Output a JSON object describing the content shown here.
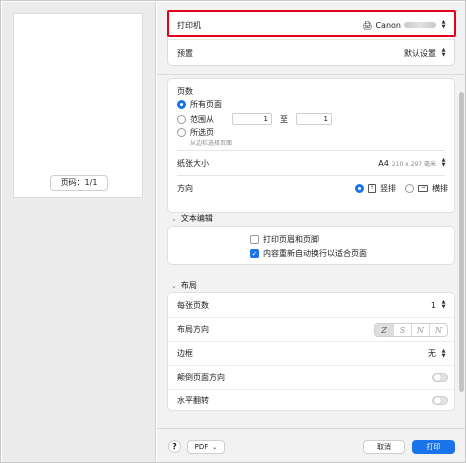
{
  "preview": {
    "page_indicator": "页码：1/1"
  },
  "printer": {
    "label": "打印机",
    "name": "Canon",
    "name_obscured": true
  },
  "preset": {
    "label": "预置",
    "value": "默认设置"
  },
  "pages": {
    "title": "页数",
    "all_pages": "所有页面",
    "range_label": "范围从",
    "range_from": "1",
    "range_to_label": "至",
    "range_to": "1",
    "selection": "所选页",
    "selection_hint": "从边栏选择页面",
    "selected_option": "all_pages"
  },
  "paper_size": {
    "label": "纸张大小",
    "value": "A4",
    "dims": "210 x 297 毫米"
  },
  "orientation": {
    "label": "方向",
    "portrait": "竖排",
    "landscape": "横排",
    "selected": "portrait"
  },
  "text_edit": {
    "section_title": "文本编辑",
    "print_headers": "打印页眉和页脚",
    "print_headers_checked": false,
    "rewrap": "内容重新自动换行以适合页面",
    "rewrap_checked": true
  },
  "layout": {
    "section_title": "布局",
    "pages_per_sheet_label": "每张页数",
    "pages_per_sheet_value": "1",
    "direction_label": "布局方向",
    "direction_options": [
      "Z",
      "S",
      "N",
      "N"
    ],
    "border_label": "边框",
    "border_value": "无",
    "reverse_label": "颠倒页面方向",
    "reverse_on": false,
    "flip_label": "水平翻转",
    "flip_on": false
  },
  "footer": {
    "help": "?",
    "pdf": "PDF",
    "cancel": "取消",
    "print": "打印"
  },
  "colors": {
    "accent": "#1a73e8",
    "highlight": "#e3001b"
  }
}
